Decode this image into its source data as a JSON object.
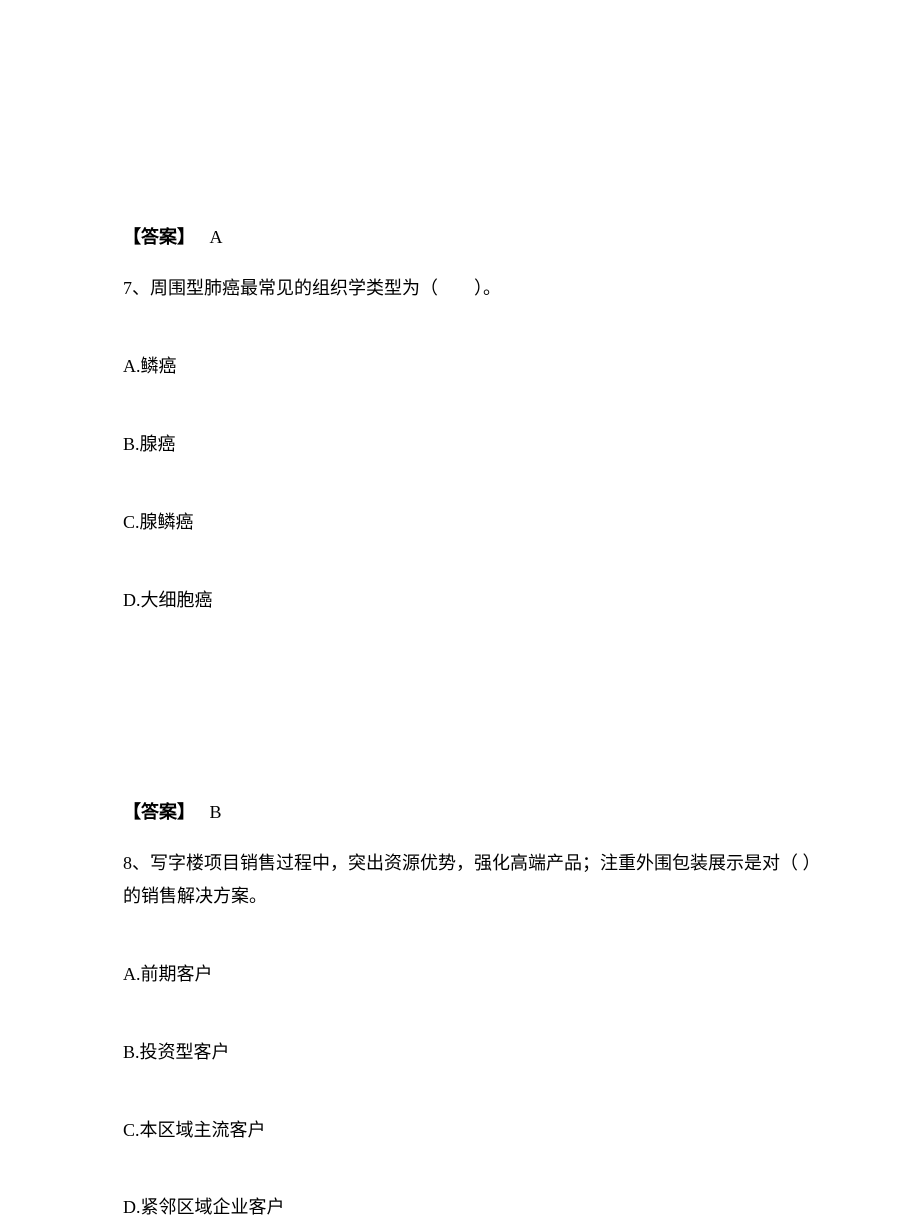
{
  "q6": {
    "answerLabel": "【答案】",
    "answerLetter": "A"
  },
  "q7": {
    "stem": "7、周围型肺癌最常见的组织学类型为（　　）。",
    "options": {
      "a": "A.鳞癌",
      "b": "B.腺癌",
      "c": "C.腺鳞癌",
      "d": "D.大细胞癌"
    },
    "answerLabel": "【答案】",
    "answerLetter": "B"
  },
  "q8": {
    "stem": "8、写字楼项目销售过程中，突出资源优势，强化高端产品；注重外围包装展示是对（ ）的销售解决方案。",
    "options": {
      "a": "A.前期客户",
      "b": "B.投资型客户",
      "c": "C.本区域主流客户",
      "d": "D.紧邻区域企业客户"
    }
  }
}
